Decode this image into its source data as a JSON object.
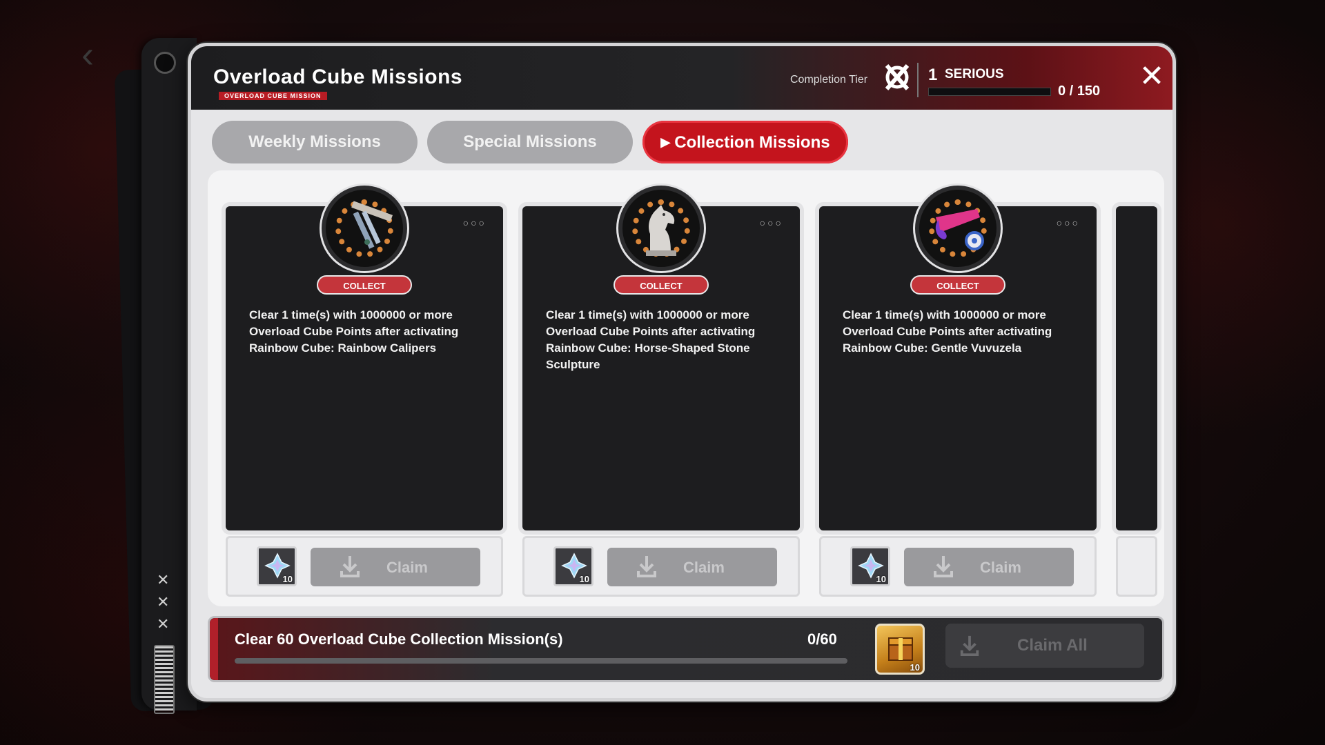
{
  "header": {
    "title": "Overload Cube Missions",
    "subtitle": "OVERLOAD CUBE MISSION",
    "tier_label": "Completion Tier",
    "tier_number": "1",
    "tier_name": "SERIOUS",
    "tier_progress_text": "0 / 150",
    "tier_progress_fraction": 0.0
  },
  "tabs": [
    {
      "label": "Weekly Missions",
      "active": false
    },
    {
      "label": "Special Missions",
      "active": false
    },
    {
      "label": "Collection Missions",
      "active": true
    }
  ],
  "cards": [
    {
      "badge": "COLLECT",
      "description": "Clear 1 time(s) with 1000000 or more Overload Cube Points after activating Rainbow Cube: Rainbow Calipers",
      "reward_qty": "10",
      "claim_label": "Claim",
      "art": "calipers"
    },
    {
      "badge": "COLLECT",
      "description": "Clear 1 time(s) with 1000000 or more Overload Cube Points after activating Rainbow Cube: Horse-Shaped Stone Sculpture",
      "reward_qty": "10",
      "claim_label": "Claim",
      "art": "horse"
    },
    {
      "badge": "COLLECT",
      "description": "Clear 1 time(s) with 1000000 or more Overload Cube Points after activating Rainbow Cube: Gentle Vuvuzela",
      "reward_qty": "10",
      "claim_label": "Claim",
      "art": "vuvuzela"
    }
  ],
  "bottom": {
    "goal_text": "Clear 60 Overload Cube Collection Mission(s)",
    "goal_count": "0/60",
    "goal_fraction": 0.0,
    "chest_qty": "10",
    "claim_all_label": "Claim All"
  },
  "colors": {
    "accent": "#c4141d",
    "card_bg": "#1d1d1f",
    "medal_ring": "#d9863a"
  }
}
